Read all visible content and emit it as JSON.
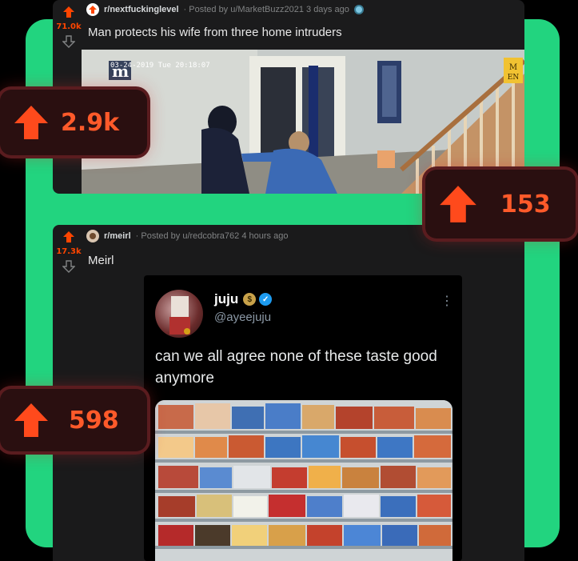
{
  "posts": [
    {
      "subreddit": "r/nextfuckinglevel",
      "meta": "· Posted by u/MarketBuzz2021 3 days ago",
      "votes": "71.0k",
      "title": "Man protects his wife from three home intruders",
      "video": {
        "timestamp": "03-24-2019 Tue 20:18:07",
        "channel_logo": "m",
        "corner_badge": "MEN"
      }
    },
    {
      "subreddit": "r/meirl",
      "meta": "· Posted by u/redcobra762 4 hours ago",
      "votes": "17.3k",
      "title": "Meirl",
      "tweet": {
        "name": "juju",
        "handle": "@ayeejuju",
        "text": "can we all agree none of these taste good anymore",
        "more_icon": "more-vertical-icon"
      }
    }
  ],
  "badges": [
    {
      "value": "2.9k",
      "icon": "upvote-arrow-icon"
    },
    {
      "value": "153",
      "icon": "upvote-arrow-icon"
    },
    {
      "value": "598",
      "icon": "upvote-arrow-icon"
    }
  ],
  "colors": {
    "accent_green": "#22d47f",
    "upvote_orange": "#ff4500",
    "badge_text": "#ff5a2a",
    "card_bg": "#1b1b1c"
  }
}
